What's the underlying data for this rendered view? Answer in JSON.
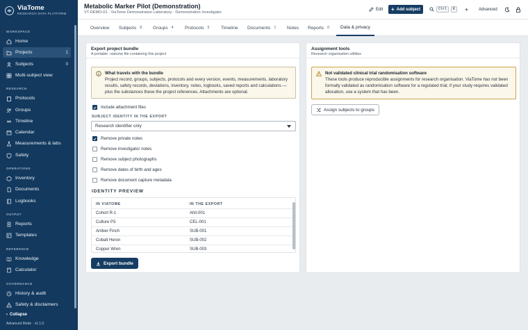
{
  "app": {
    "name": "ViaTome",
    "tagline": "RESEARCH DATA PLATFORM",
    "mode": "Advanced Mode · v1.1.0",
    "collapse": "Collapse"
  },
  "sidebar": {
    "sections": {
      "workspace": "WORKSPACE",
      "research": "RESEARCH",
      "operations": "OPERATIONS",
      "output": "OUTPUT",
      "reference": "REFERENCE",
      "governance": "GOVERNANCE"
    },
    "items": {
      "home": "Home",
      "projects": "Projects",
      "projects_count": "1",
      "subjects": "Subjects",
      "subjects_count": "0",
      "multi": "Multi-subject view",
      "protocols": "Protocols",
      "groups": "Groups",
      "timeline": "Timeline",
      "calendar": "Calendar",
      "measurements": "Measurements & labs",
      "safety": "Safety",
      "inventory": "Inventory",
      "documents": "Documents",
      "logbooks": "Logbooks",
      "reports": "Reports",
      "templates": "Templates",
      "knowledge": "Knowledge",
      "calculator": "Calculator",
      "history": "History & audit",
      "disclaimers": "Safety & disclaimers"
    }
  },
  "header": {
    "title": "Metabolic Marker Pilot (Demonstration)",
    "subtitle": "VT-DEMO-01 · ViaTome Demonstration Laboratory · Demonstration Investigator",
    "edit": "Edit",
    "add_subject": "Add subject",
    "kbd1": "Ctrl",
    "kbd2": "K",
    "advanced": "Advanced"
  },
  "tabs": [
    {
      "label": "Overview",
      "count": ""
    },
    {
      "label": "Subjects",
      "count": "8"
    },
    {
      "label": "Groups",
      "count": "4"
    },
    {
      "label": "Protocols",
      "count": "5"
    },
    {
      "label": "Timeline",
      "count": ""
    },
    {
      "label": "Documents",
      "count": "1"
    },
    {
      "label": "Notes",
      "count": ""
    },
    {
      "label": "Reports",
      "count": "0"
    },
    {
      "label": "Data & privacy",
      "count": ""
    }
  ],
  "export": {
    "title": "Export project bundle",
    "subtitle": "A portable .viatome file containing this project",
    "note_title": "What travels with the bundle",
    "note_body": "Project record, groups, subjects, protocols and every version, events, measurements, laboratory results, safety records, deviations, inventory, notes, logbooks, saved reports and calculations — plus the substances these the project references. Attachments are optional.",
    "include_attachments": "Include attachment files",
    "identity_label": "SUBJECT IDENTITY IN THE EXPORT",
    "identity_value": "Research identifier only",
    "options": [
      {
        "label": "Remove private notes",
        "checked": true
      },
      {
        "label": "Remove investigator notes",
        "checked": false
      },
      {
        "label": "Remove subject photographs",
        "checked": false
      },
      {
        "label": "Remove dates of birth and ages",
        "checked": false
      },
      {
        "label": "Remove document capture metadata",
        "checked": false
      }
    ],
    "preview_title": "IDENTITY PREVIEW",
    "col_in": "IN VIATOME",
    "col_out": "IN THE EXPORT",
    "rows": [
      {
        "in": "Cohort R-1",
        "out": "ANI-001"
      },
      {
        "in": "Culture P3",
        "out": "CEL-001"
      },
      {
        "in": "Amber Finch",
        "out": "SUB-001"
      },
      {
        "in": "Cobalt Heron",
        "out": "SUB-002"
      },
      {
        "in": "Copper Wren",
        "out": "SUB-003"
      }
    ],
    "button": "Export bundle"
  },
  "assignment": {
    "title": "Assignment tools",
    "subtitle": "Research organisation utilities",
    "note_title": "Not validated clinical trial randomisation software",
    "note_body": "These tools produce reproducible assignments for research organisation. ViaTome has not been formally validated as randomisation software for a regulated trial; if your study requires validated allocation, use a system that has been.",
    "button": "Assign subjects to groups"
  },
  "colors": {
    "sidebar": "#13395e",
    "primary": "#163d63",
    "warning": "#c9a44b"
  }
}
